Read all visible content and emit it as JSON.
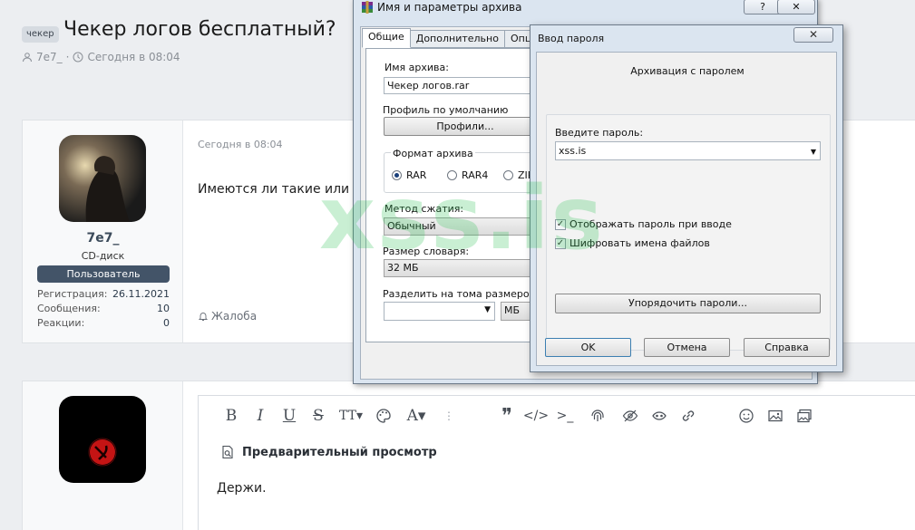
{
  "thread": {
    "prefix": "чекер",
    "title": "Чекер логов бесплатный?",
    "author": "7e7_",
    "separator": "·",
    "date": "Сегодня в 08:04"
  },
  "post1": {
    "username": "7e7_",
    "user_title": "CD-диск",
    "user_banner": "Пользователь",
    "stats": [
      {
        "label": "Регистрация:",
        "value": "26.11.2021"
      },
      {
        "label": "Сообщения:",
        "value": "10"
      },
      {
        "label": "Реакции:",
        "value": "0"
      }
    ],
    "date": "Сегодня в 08:04",
    "body": "Имеются ли такие или то",
    "report_label": "Жалоба"
  },
  "editor": {
    "toolbar_icons": [
      "bold-icon",
      "italic-icon",
      "underline-icon",
      "strikethrough-icon",
      "text-size-icon",
      "palette-icon",
      "font-color-icon",
      "more-vertical-icon",
      "quote-icon",
      "code-icon",
      "inline-code-icon",
      "fingerprint-icon",
      "hide-icon",
      "spoiler-icon",
      "link-icon",
      "smile-icon",
      "image-icon",
      "media-icon"
    ],
    "preview_label": "Предварительный просмотр",
    "content": "Держи."
  },
  "archive_dialog": {
    "title": "Имя и параметры архива",
    "help_btn": "?",
    "close_btn": "✕",
    "tabs": [
      "Общие",
      "Дополнительно",
      "Опции"
    ],
    "archive_name_label": "Имя архива:",
    "archive_name_value": "Чекер логов.rar",
    "profile_label": "Профиль по умолчанию",
    "profiles_button": "Профили...",
    "format_label": "Формат архива",
    "formats": [
      {
        "label": "RAR",
        "selected": true
      },
      {
        "label": "RAR4",
        "selected": false
      },
      {
        "label": "ZIP",
        "selected": false
      }
    ],
    "method_label": "Метод сжатия:",
    "method_value": "Обычный",
    "dict_label": "Размер словаря:",
    "dict_value": "32 МБ",
    "split_label": "Разделить на тома размером:",
    "split_value": "",
    "split_unit": "МБ"
  },
  "password_dialog": {
    "title": "Ввод пароля",
    "close_btn": "✕",
    "header": "Архивация с паролем",
    "password_label": "Введите пароль:",
    "password_value": "xss.is",
    "show_password_label": "Отображать пароль при вводе",
    "show_password_checked": true,
    "encrypt_names_label": "Шифровать имена файлов",
    "encrypt_names_checked": true,
    "organize_button": "Упорядочить пароли...",
    "ok_button": "OK",
    "cancel_button": "Отмена",
    "help_button": "Справка"
  },
  "watermark": "xss.is"
}
